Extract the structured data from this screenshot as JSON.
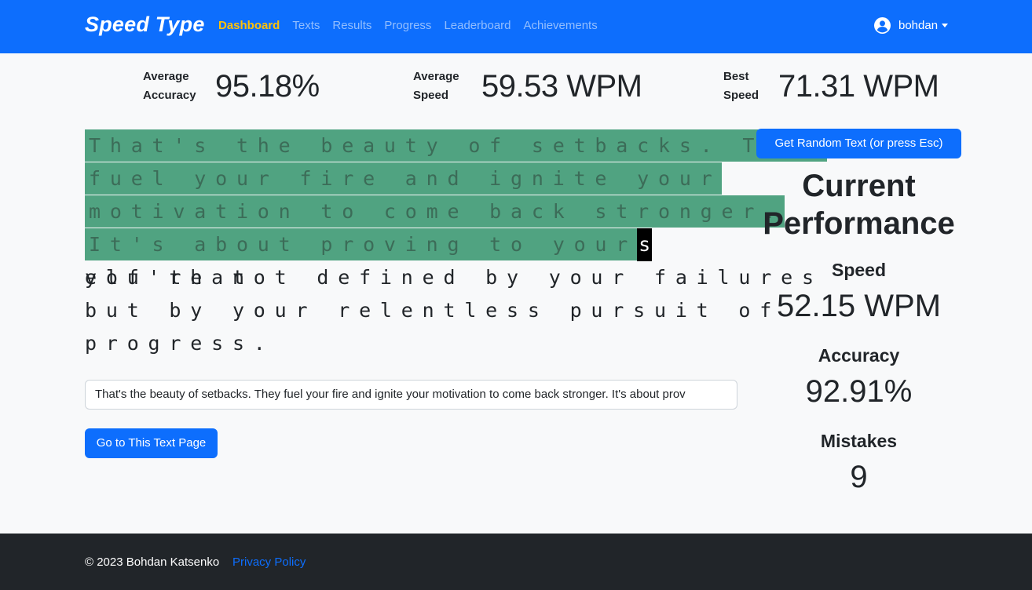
{
  "navbar": {
    "brand": "Speed Type",
    "links": [
      "Dashboard",
      "Texts",
      "Results",
      "Progress",
      "Leaderboard",
      "Achievements"
    ],
    "active": "Dashboard",
    "user": "bohdan"
  },
  "stats": {
    "avg_accuracy_label": "Average Accuracy",
    "avg_accuracy_value": "95.18%",
    "avg_speed_label": "Average Speed",
    "avg_speed_value": "59.53 WPM",
    "best_speed_label": "Best Speed",
    "best_speed_value": "71.31 WPM"
  },
  "typing": {
    "lines": [
      {
        "typed": "That's the beauty of setbacks. They",
        "cursor": "",
        "rest": ""
      },
      {
        "typed": "fuel your fire and ignite your",
        "cursor": "",
        "rest": ""
      },
      {
        "typed": "motivation to come back stronger.",
        "cursor": "",
        "rest": ""
      },
      {
        "typed": "It's about proving to your",
        "cursor": "s",
        "rest": "elf that"
      },
      {
        "typed": "",
        "cursor": "",
        "rest": "you're not defined by your failures"
      },
      {
        "typed": "",
        "cursor": "",
        "rest": "but by your relentless pursuit of"
      },
      {
        "typed": "",
        "cursor": "",
        "rest": "progress."
      }
    ],
    "input_value": "That's the beauty of setbacks. They fuel your fire and ignite your motivation to come back stronger. It's about prov",
    "go_button": "Go to This Text Page",
    "random_button": "Get Random Text (or press Esc)"
  },
  "performance": {
    "title": "Current Performance",
    "speed_label": "Speed",
    "speed_value": "52.15 WPM",
    "accuracy_label": "Accuracy",
    "accuracy_value": "92.91%",
    "mistakes_label": "Mistakes",
    "mistakes_value": "9"
  },
  "footer": {
    "copyright": "© 2023 Bohdan Katsenko",
    "privacy": "Privacy Policy"
  },
  "colors": {
    "primary": "#0d6efd",
    "active_nav": "#ffc107",
    "typed_bg": "#50a381",
    "footer_bg": "#212529"
  }
}
